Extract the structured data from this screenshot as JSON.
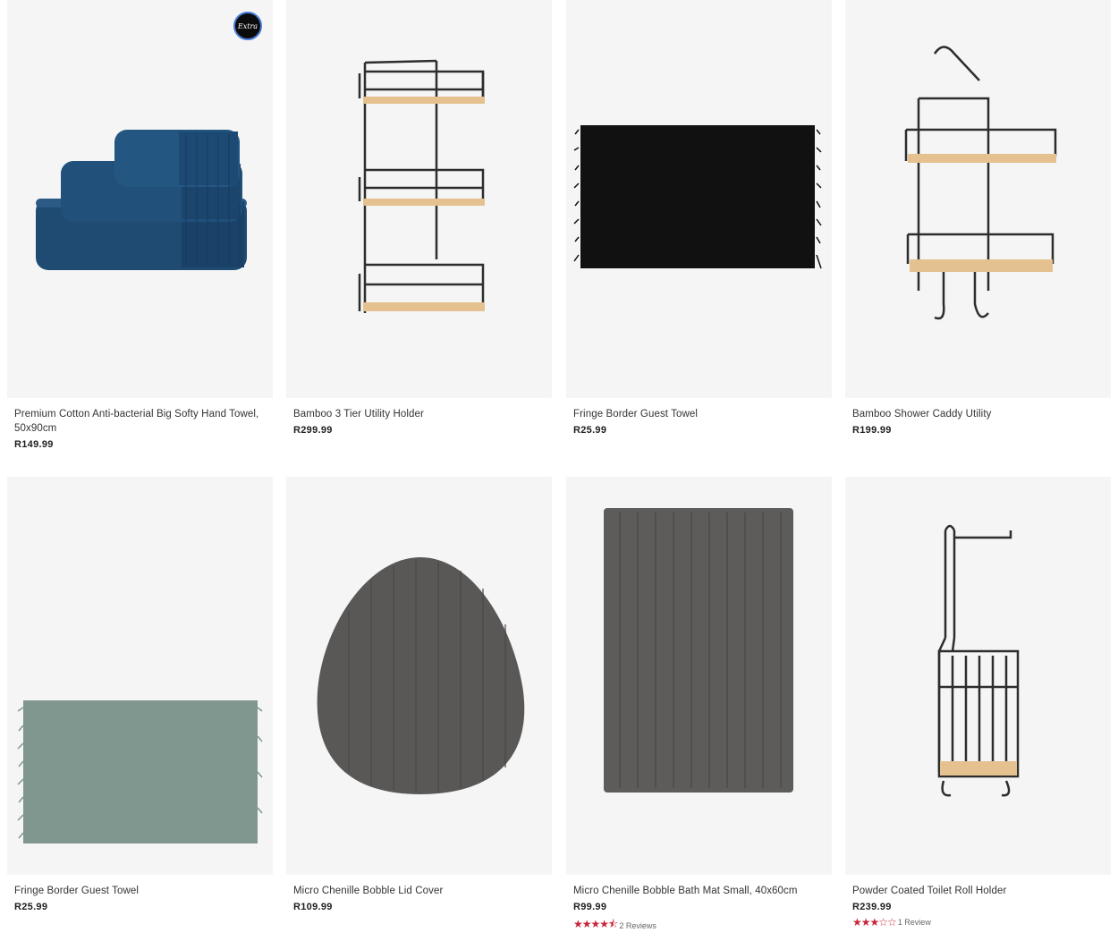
{
  "products": [
    {
      "title": "Premium Cotton Anti-bacterial Big Softy Hand Towel, 50x90cm",
      "price": "R149.99",
      "badge": "Extra"
    },
    {
      "title": "Bamboo 3 Tier Utility Holder",
      "price": "R299.99"
    },
    {
      "title": "Fringe Border Guest Towel",
      "price": "R25.99"
    },
    {
      "title": "Bamboo Shower Caddy Utility",
      "price": "R199.99"
    },
    {
      "title": "Fringe Border Guest Towel",
      "price": "R25.99"
    },
    {
      "title": "Micro Chenille Bobble Lid Cover",
      "price": "R109.99"
    },
    {
      "title": "Micro Chenille Bobble Bath Mat Small, 40x60cm",
      "price": "R99.99",
      "rating": {
        "stars": 4.5,
        "stars_text": "★★★★⯪",
        "reviews": "2 Reviews"
      }
    },
    {
      "title": "Powder Coated Toilet Roll Holder",
      "price": "R239.99",
      "rating": {
        "stars": 3,
        "stars_text": "★★★☆☆",
        "reviews": "1 Review"
      }
    }
  ],
  "colors": {
    "tile_bg": "#f5f5f5",
    "star": "#c8243a",
    "navy_towel": "#1f4a72",
    "sage_towel": "#7f978e",
    "charcoal": "#5a5757",
    "bamboo": "#e5c190"
  }
}
